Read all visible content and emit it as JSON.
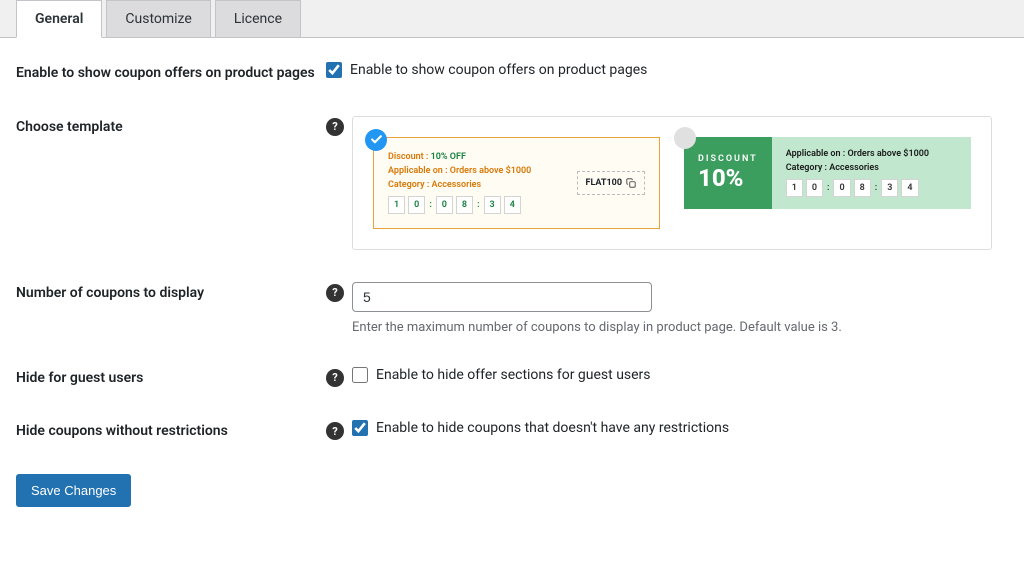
{
  "tabs": {
    "general": "General",
    "customize": "Customize",
    "licence": "Licence"
  },
  "fields": {
    "enable_offers": {
      "label": "Enable to show coupon offers on product pages",
      "checkbox_label": "Enable to show coupon offers on product pages",
      "checked": true
    },
    "choose_template": {
      "label": "Choose template",
      "template_a": {
        "discount_prefix": "Discount : ",
        "discount_value": "10% OFF",
        "applicable": "Applicable on : Orders above $1000",
        "category": "Category : Accessories",
        "code": "FLAT100",
        "countdown": [
          "1",
          "0",
          "0",
          "8",
          "3",
          "4"
        ]
      },
      "template_b": {
        "discount_label": "DISCOUNT",
        "discount_pct": "10%",
        "applicable": "Applicable on : Orders above $1000",
        "category": "Category : Accessories",
        "countdown": [
          "1",
          "0",
          "0",
          "8",
          "3",
          "4"
        ]
      }
    },
    "num_coupons": {
      "label": "Number of coupons to display",
      "value": "5",
      "description": "Enter the maximum number of coupons to display in product page. Default value is 3."
    },
    "hide_guest": {
      "label": "Hide for guest users",
      "checkbox_label": "Enable to hide offer sections for guest users",
      "checked": false
    },
    "hide_no_restrictions": {
      "label": "Hide coupons without restrictions",
      "checkbox_label": "Enable to hide coupons that doesn't have any restrictions",
      "checked": true
    }
  },
  "save_button": "Save Changes"
}
